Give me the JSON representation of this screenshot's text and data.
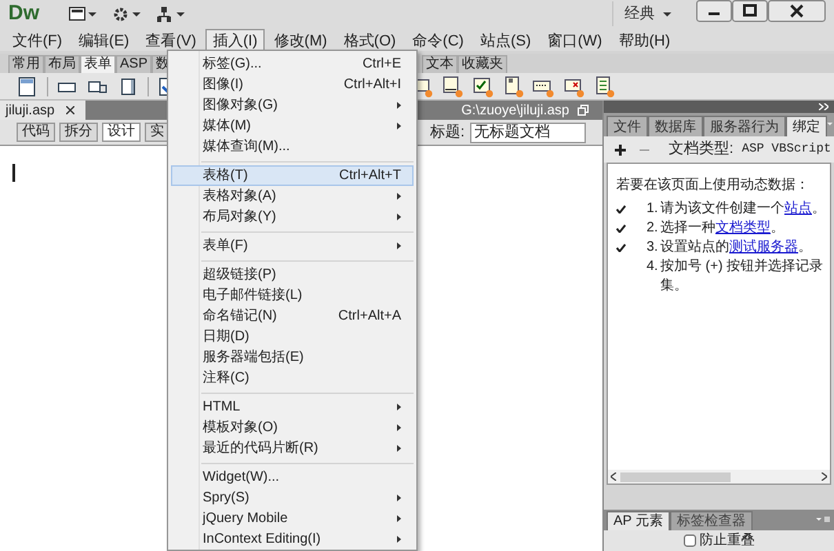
{
  "title_bar": {
    "logo": "Dw",
    "workspace": "经典"
  },
  "menu_bar": [
    {
      "label": "文件(F)",
      "selected": false
    },
    {
      "label": "编辑(E)",
      "selected": false
    },
    {
      "label": "查看(V)",
      "selected": false
    },
    {
      "label": "插入(I)",
      "selected": true
    },
    {
      "label": "修改(M)",
      "selected": false
    },
    {
      "label": "格式(O)",
      "selected": false
    },
    {
      "label": "命令(C)",
      "selected": false
    },
    {
      "label": "站点(S)",
      "selected": false
    },
    {
      "label": "窗口(W)",
      "selected": false
    },
    {
      "label": "帮助(H)",
      "selected": false
    }
  ],
  "insert_panel": {
    "tabs_left": [
      {
        "label": "常用",
        "selected": false
      },
      {
        "label": "布局",
        "selected": false
      },
      {
        "label": "表单",
        "selected": true
      },
      {
        "label": "ASP",
        "selected": false
      },
      {
        "label": "数",
        "selected": false
      }
    ],
    "tabs_right": [
      {
        "label": "文本",
        "selected": false
      },
      {
        "label": "收藏夹",
        "selected": false
      }
    ]
  },
  "document": {
    "file_tab": "jiluji.asp",
    "path": "G:\\zuoye\\jiluji.asp",
    "view_buttons": [
      {
        "label": "代码",
        "selected": false
      },
      {
        "label": "拆分",
        "selected": false
      },
      {
        "label": "设计",
        "selected": true
      },
      {
        "label": "实",
        "selected": false
      }
    ],
    "title_label": "标题:",
    "title_value": "无标题文档"
  },
  "insert_menu": [
    {
      "kind": "item",
      "label": "标签(G)...",
      "shortcut": "Ctrl+E",
      "submenu": false,
      "selected": false
    },
    {
      "kind": "item",
      "label": "图像(I)",
      "shortcut": "Ctrl+Alt+I",
      "submenu": false,
      "selected": false
    },
    {
      "kind": "item",
      "label": "图像对象(G)",
      "submenu": true,
      "selected": false
    },
    {
      "kind": "item",
      "label": "媒体(M)",
      "submenu": true,
      "selected": false
    },
    {
      "kind": "item",
      "label": "媒体查询(M)...",
      "submenu": false,
      "selected": false
    },
    {
      "kind": "separator"
    },
    {
      "kind": "item",
      "label": "表格(T)",
      "shortcut": "Ctrl+Alt+T",
      "submenu": false,
      "selected": true
    },
    {
      "kind": "item",
      "label": "表格对象(A)",
      "submenu": true,
      "selected": false
    },
    {
      "kind": "item",
      "label": "布局对象(Y)",
      "submenu": true,
      "selected": false
    },
    {
      "kind": "separator"
    },
    {
      "kind": "item",
      "label": "表单(F)",
      "submenu": true,
      "selected": false
    },
    {
      "kind": "separator"
    },
    {
      "kind": "item",
      "label": "超级链接(P)",
      "submenu": false,
      "selected": false
    },
    {
      "kind": "item",
      "label": "电子邮件链接(L)",
      "submenu": false,
      "selected": false
    },
    {
      "kind": "item",
      "label": "命名锚记(N)",
      "shortcut": "Ctrl+Alt+A",
      "submenu": false,
      "selected": false
    },
    {
      "kind": "item",
      "label": "日期(D)",
      "submenu": false,
      "selected": false
    },
    {
      "kind": "item",
      "label": "服务器端包括(E)",
      "submenu": false,
      "selected": false
    },
    {
      "kind": "item",
      "label": "注释(C)",
      "submenu": false,
      "selected": false
    },
    {
      "kind": "separator"
    },
    {
      "kind": "item",
      "label": "HTML",
      "submenu": true,
      "selected": false
    },
    {
      "kind": "item",
      "label": "模板对象(O)",
      "submenu": true,
      "selected": false
    },
    {
      "kind": "item",
      "label": "最近的代码片断(R)",
      "submenu": true,
      "selected": false
    },
    {
      "kind": "separator"
    },
    {
      "kind": "item",
      "label": "Widget(W)...",
      "submenu": false,
      "selected": false
    },
    {
      "kind": "item",
      "label": "Spry(S)",
      "submenu": true,
      "selected": false
    },
    {
      "kind": "item",
      "label": "jQuery Mobile",
      "submenu": true,
      "selected": false
    },
    {
      "kind": "item",
      "label": "InContext Editing(I)",
      "submenu": true,
      "selected": false
    }
  ],
  "right_panel": {
    "tabs": [
      {
        "label": "文件",
        "selected": false
      },
      {
        "label": "数据库",
        "selected": false
      },
      {
        "label": "服务器行为",
        "selected": false
      },
      {
        "label": "绑定",
        "selected": true
      }
    ],
    "doc_type_label": "文档类型:",
    "doc_type": "ASP VBScript",
    "intro": "若要在该页面上使用动态数据：",
    "steps": [
      {
        "number": "1.",
        "text": "请为该文件创建一个",
        "link": "站点",
        "after": "。",
        "checked": true
      },
      {
        "number": "2.",
        "text": "选择一种",
        "link": "文档类型",
        "after": "。",
        "checked": true
      },
      {
        "number": "3.",
        "text": "设置站点的",
        "link": "测试服务器",
        "after": "。",
        "checked": true
      },
      {
        "number": "4.",
        "text": "按加号 (+) 按钮并选择记录集。",
        "checked": false
      }
    ]
  },
  "bottom_panel": {
    "tabs": [
      {
        "label": "AP 元素",
        "selected": true
      },
      {
        "label": "标签检查器",
        "selected": false
      }
    ],
    "checkbox": {
      "label": "防止重叠",
      "checked": false
    }
  }
}
